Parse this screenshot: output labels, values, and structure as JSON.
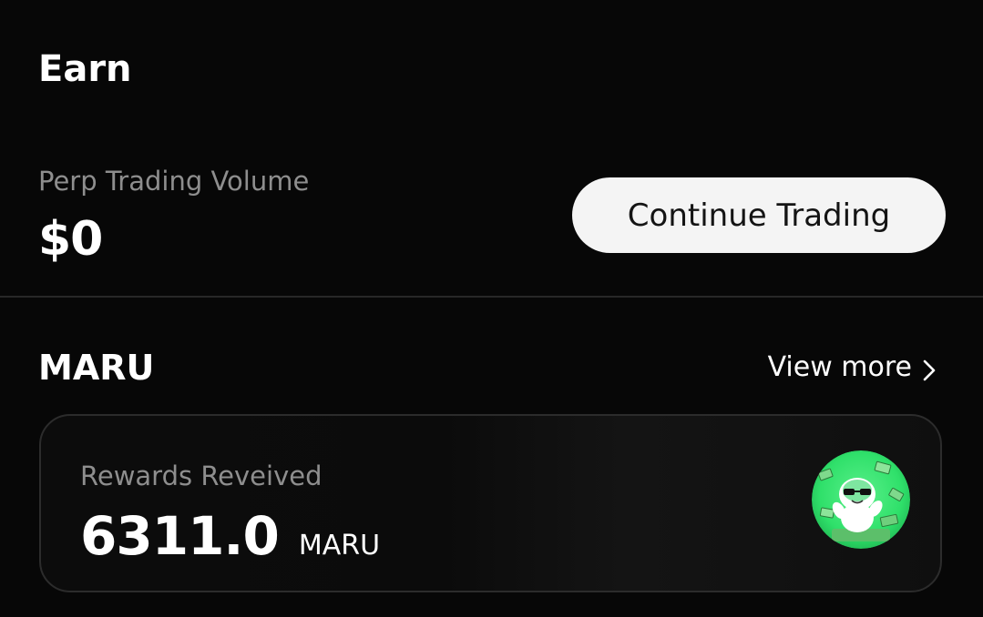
{
  "earn": {
    "title": "Earn",
    "perp_label": "Perp Trading Volume",
    "perp_value": "$0",
    "continue_button": "Continue Trading"
  },
  "token": {
    "name": "MARU",
    "view_more": "View more",
    "view_more_icon": "chevron-right-icon",
    "card": {
      "label": "Rewards Reveived",
      "value": "6311.0",
      "unit": "MARU",
      "avatar_icon": "maru-token-avatar"
    }
  },
  "colors": {
    "background": "#070707",
    "button_bg": "#f4f4f4",
    "muted_text": "#8e8e8e",
    "avatar_green": "#2fe06a"
  }
}
